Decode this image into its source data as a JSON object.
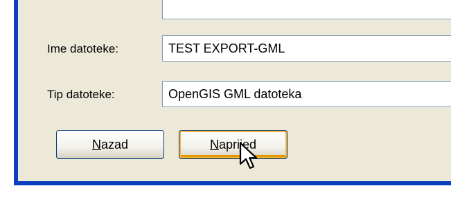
{
  "dialog": {
    "top_field": {
      "value": ""
    },
    "filename": {
      "label": "Ime datoteke:",
      "value": "TEST EXPORT-GML"
    },
    "filetype": {
      "label": "Tip datoteke:",
      "value": "OpenGIS GML datoteka"
    },
    "buttons": {
      "back": "Nazad",
      "next": "Naprijed"
    }
  },
  "colors": {
    "dialog_bg": "#ece9d8",
    "frame_blue": "#0b3fbf",
    "button_focus": "#f8b33b"
  },
  "cursor": {
    "icon": "arrow-cursor-icon"
  }
}
